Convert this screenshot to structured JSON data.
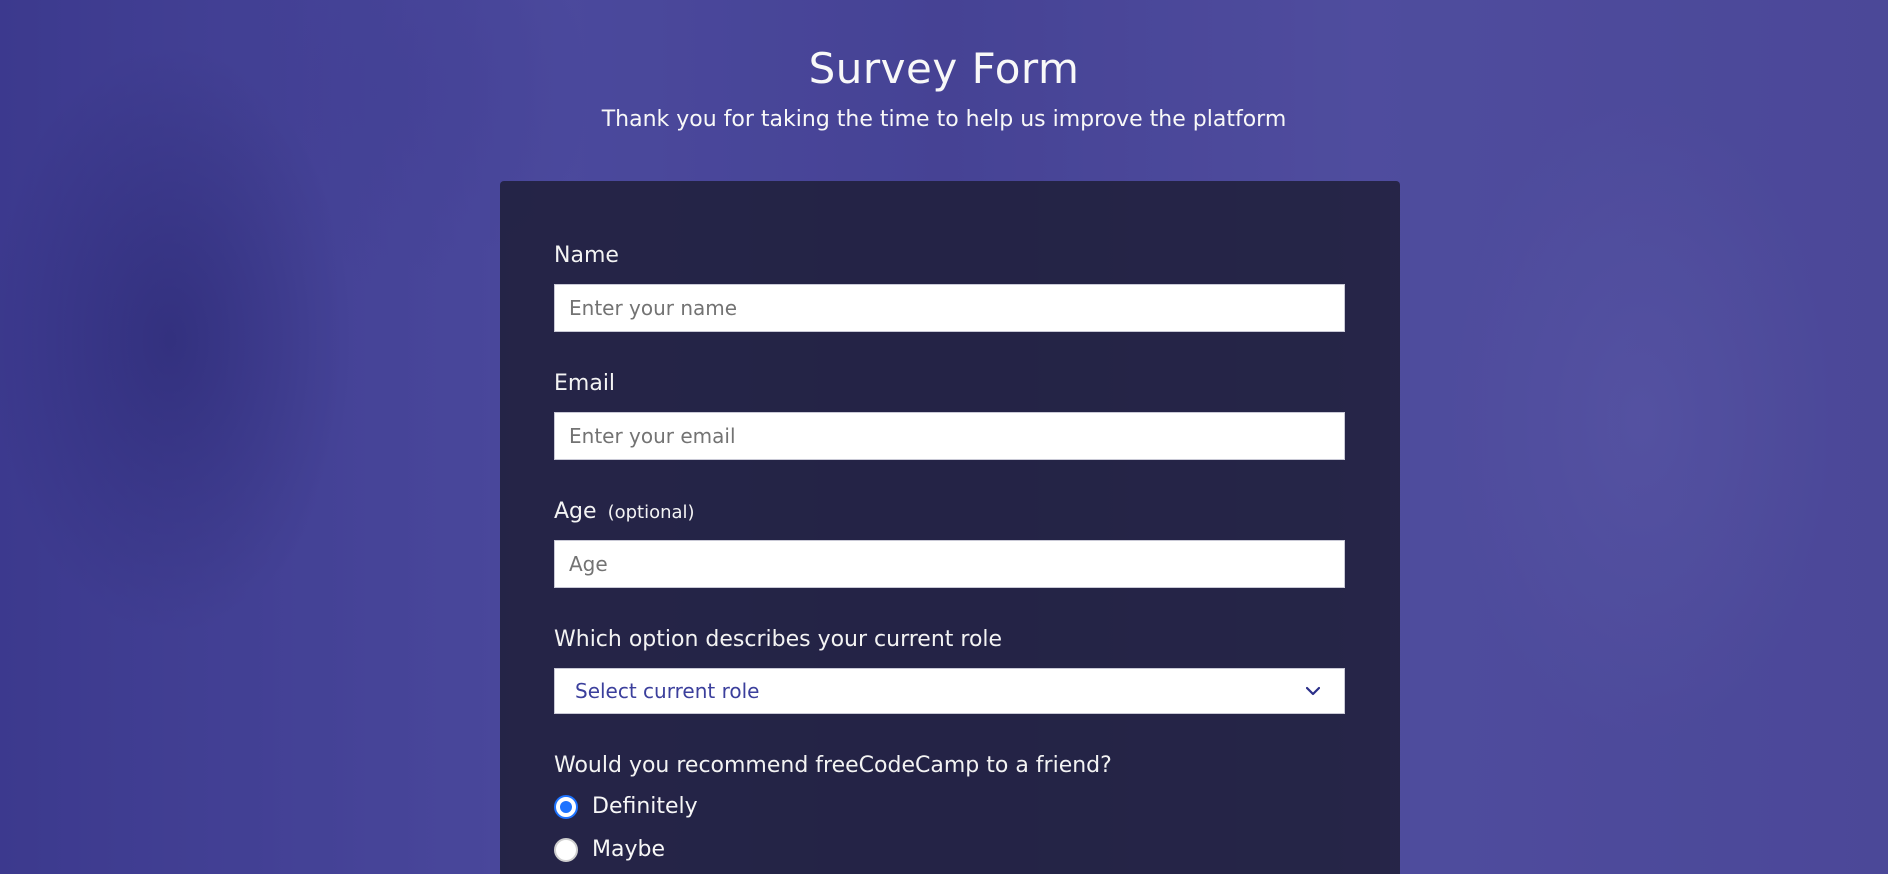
{
  "header": {
    "title": "Survey Form",
    "subtitle": "Thank you for taking the time to help us improve the platform"
  },
  "form": {
    "name": {
      "label": "Name",
      "placeholder": "Enter your name"
    },
    "email": {
      "label": "Email",
      "placeholder": "Enter your email"
    },
    "age": {
      "label": "Age",
      "optional": "(optional)",
      "placeholder": "Age"
    },
    "role": {
      "label": "Which option describes your current role",
      "selected": "Select current role"
    },
    "recommend": {
      "label": "Would you recommend freeCodeCamp to a friend?",
      "options": [
        "Definitely",
        "Maybe"
      ],
      "selected_index": 0
    }
  },
  "colors": {
    "background": "#4e4b9d",
    "card": "#1b1b32",
    "select_text": "#3b3f9c",
    "radio_accent": "#1e73ff"
  },
  "icons": [
    "chevron-down-icon",
    "radio-checked-icon",
    "radio-unchecked-icon"
  ]
}
